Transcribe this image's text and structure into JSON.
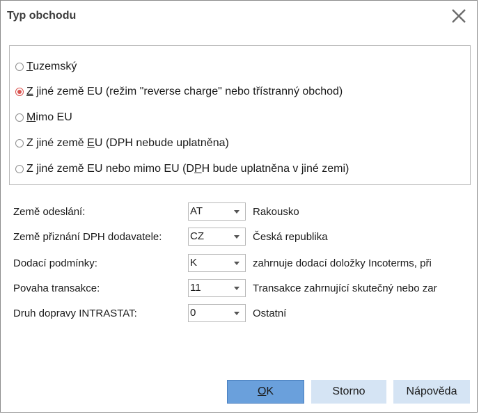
{
  "dialog": {
    "title": "Typ obchodu"
  },
  "trade_type": {
    "options": [
      {
        "mnemonic": "T",
        "rest": "uzemský",
        "pre": "",
        "checked": false
      },
      {
        "pre": "",
        "mnemonic": "Z",
        "rest": " jiné země EU (režim \"reverse charge\" nebo třístranný obchod)",
        "checked": true
      },
      {
        "pre": "",
        "mnemonic": "M",
        "rest": "imo EU",
        "checked": false
      },
      {
        "pre": "Z jiné země ",
        "mnemonic": "E",
        "rest": "U (DPH nebude uplatněna)",
        "checked": false
      },
      {
        "pre": "Z jiné země EU nebo mimo EU (D",
        "mnemonic": "P",
        "rest": "H bude uplatněna v jiné zemi)",
        "checked": false
      }
    ]
  },
  "fields": [
    {
      "label": "Země odeslání:",
      "value": "AT",
      "description": "Rakousko"
    },
    {
      "label": "Země přiznání DPH dodavatele:",
      "value": "CZ",
      "description": "Česká republika"
    },
    {
      "label": "Dodací podmínky:",
      "value": "K",
      "description": "zahrnuje dodací doložky Incoterms, při"
    },
    {
      "label": "Povaha transakce:",
      "value": "11",
      "description": "Transakce zahrnující skutečný nebo zar"
    },
    {
      "label": "Druh dopravy INTRASTAT:",
      "value": "0",
      "description": "Ostatní"
    }
  ],
  "buttons": {
    "ok_mnemonic": "O",
    "ok_rest": "K",
    "cancel": "Storno",
    "help": "Nápověda"
  },
  "colors": {
    "ok_button": "#6aa0dc",
    "secondary_button": "#d5e4f4",
    "radio_checked": "#d9534f"
  }
}
